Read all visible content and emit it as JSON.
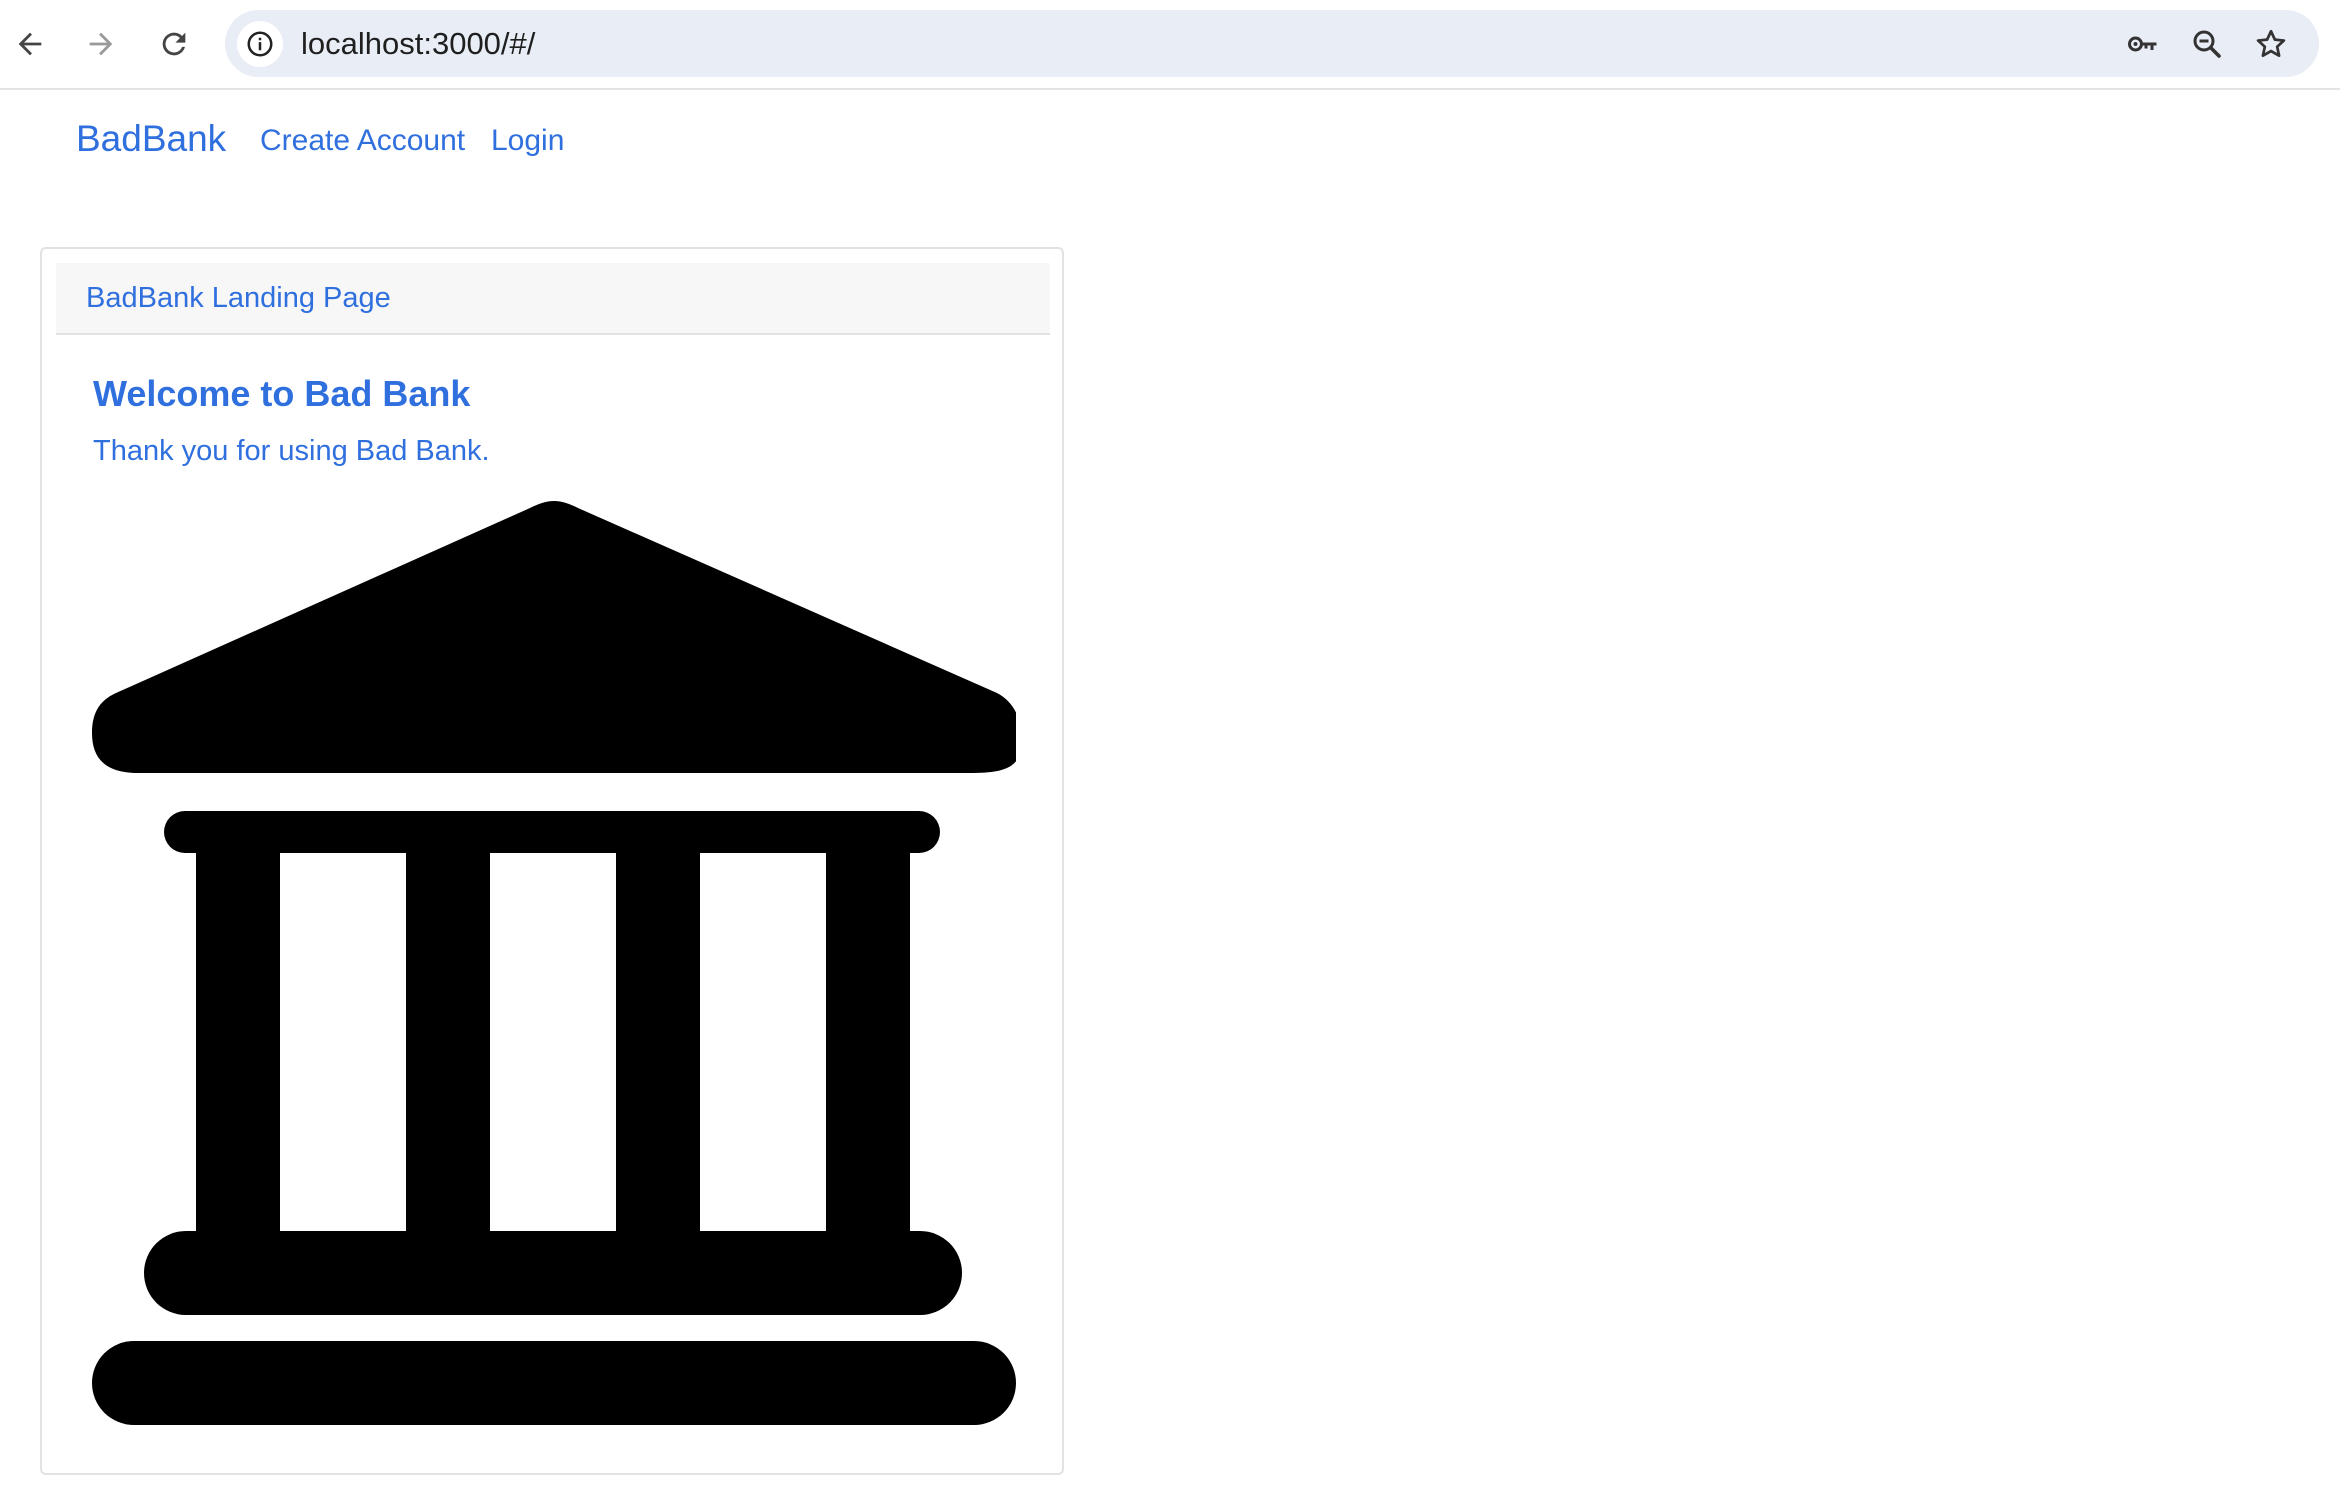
{
  "browser": {
    "url": "localhost:3000/#/",
    "back_icon": "back-arrow-icon",
    "forward_icon": "forward-arrow-icon",
    "reload_icon": "reload-icon",
    "site_info_icon": "info-icon",
    "password_icon": "key-icon",
    "zoom_icon": "zoom-out-icon",
    "bookmark_icon": "star-icon"
  },
  "navbar": {
    "brand": "BadBank",
    "links": [
      "Create Account",
      "Login"
    ]
  },
  "card": {
    "header": "BadBank Landing Page",
    "title": "Welcome to Bad Bank",
    "text": "Thank you for using Bad Bank.",
    "image_icon": "bank-icon"
  },
  "colors": {
    "link": "#2f6fde",
    "omnibox_bg": "#e9edf5",
    "card_header_bg": "#f7f7f7",
    "icon": "#000000"
  }
}
